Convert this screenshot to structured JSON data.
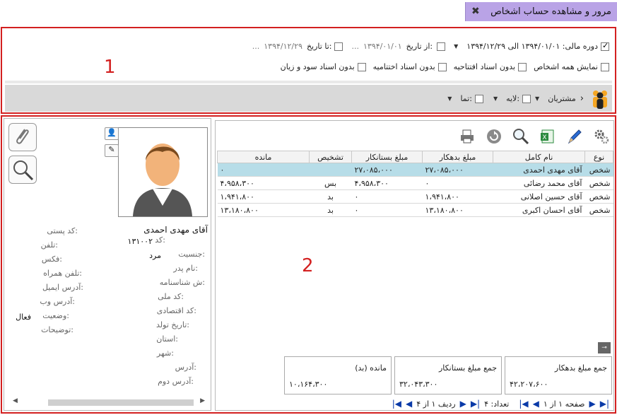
{
  "window": {
    "title": "مرور و مشاهده حساب اشخاص",
    "close_icon": "close-icon"
  },
  "callouts": {
    "one": "1",
    "two": "2"
  },
  "filters": {
    "period_label": "دوره مالی: ۱۳۹۴/۰۱/۰۱ الی ۱۳۹۴/۱۲/۲۹",
    "from_label": "از تاریخ:",
    "from_value": "۱۳۹۴/۰۱/۰۱",
    "to_label": "تا تاریخ:",
    "to_value": "۱۳۹۴/۱۲/۲۹",
    "ellipsis": "...",
    "show_all": "نمایش همه اشخاص",
    "no_opening": "بدون اسناد افتتاحیه",
    "no_closing": "بدون اسناد اختتامیه",
    "no_pl": "بدون اسناد سود و زیان"
  },
  "group_bar": {
    "group": "مشتریان",
    "layer": "لایه:",
    "all": "تما:"
  },
  "grid": {
    "headers": [
      "نوع",
      "نام کامل",
      "مبلغ بدهکار",
      "مبلغ بستانکار",
      "تشخیص",
      "مانده"
    ],
    "rows": [
      {
        "type": "شخص",
        "name": "آقای مهدی احمدی",
        "debit": "۲۷،۰۸۵،۰۰۰",
        "credit": "۲۷،۰۸۵،۰۰۰",
        "status": "",
        "balance": "۰"
      },
      {
        "type": "شخص",
        "name": "آقای محمد رضائی",
        "debit": "۰",
        "credit": "۴،۹۵۸،۳۰۰",
        "status": "بس",
        "balance": "۴،۹۵۸،۳۰۰"
      },
      {
        "type": "شخص",
        "name": "آقای حسین اصلانی",
        "debit": "۱،۹۴۱،۸۰۰",
        "credit": "۰",
        "status": "بد",
        "balance": "۱،۹۴۱،۸۰۰"
      },
      {
        "type": "شخص",
        "name": "آقای احسان اکبری",
        "debit": "۱۳،۱۸۰،۸۰۰",
        "credit": "۰",
        "status": "بد",
        "balance": "۱۳،۱۸۰،۸۰۰"
      }
    ]
  },
  "totals": {
    "debit_label": "جمع مبلغ بدهکار",
    "debit_value": "۴۲،۲۰۷،۶۰۰",
    "credit_label": "جمع مبلغ بستانکار",
    "credit_value": "۳۲،۰۴۳،۳۰۰",
    "balance_label": "مانده (بد)",
    "balance_value": "۱۰،۱۶۴،۳۰۰"
  },
  "nav": {
    "page_label": "صفحه ۱ از ۱",
    "count_label": "تعداد: ۴",
    "row_label": "ردیف ۱ از ۴"
  },
  "detail": {
    "name": "آقای مهدی احمدی",
    "code_label": "کد:",
    "code_value": "۱۳۱۰۰۲",
    "gender_label": "جنسیت:",
    "gender_value": "مرد",
    "father_label": "نام پدر:",
    "id_label": "ش شناسنامه:",
    "national_label": "کد ملی:",
    "economic_label": "کد اقتصادی:",
    "birth_label": "تاریخ تولد:",
    "province_label": "استان:",
    "city_label": "شهر:",
    "address_label": "آدرس:",
    "address2_label": "آدرس دوم:",
    "postal_label": "کد پستی:",
    "phone_label": "تلفن:",
    "fax_label": "فکس:",
    "mobile_label": "تلفن همراه:",
    "email_label": "آدرس ایمیل:",
    "web_label": "آدرس وب:",
    "state_label": "وضعیت:",
    "state_value": "فعال",
    "notes_label": "توضیحات:"
  },
  "colors": {
    "title_bg": "#b9a3e6",
    "callout_red": "#d32020",
    "selected_row": "#b7dde8",
    "nav_blue": "#0a3aa8"
  }
}
